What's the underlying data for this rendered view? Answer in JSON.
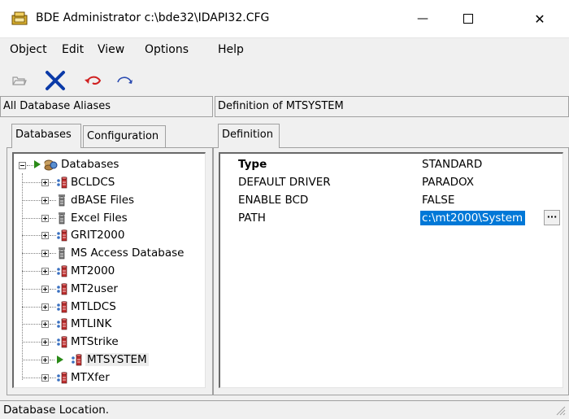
{
  "window": {
    "title": "BDE Administrator  c:\\bde32\\IDAPI32.CFG",
    "minimize_symbol": "—",
    "close_symbol": "✕"
  },
  "menu": {
    "object": "Object",
    "edit": "Edit",
    "view": "View",
    "options": "Options",
    "help": "Help"
  },
  "toolbar": {
    "icons": [
      "open-icon",
      "delete-icon",
      "undo-icon",
      "redo-icon"
    ]
  },
  "left_pane": {
    "header": "All Database Aliases",
    "tabs": [
      "Databases",
      "Configuration"
    ],
    "tree": {
      "root": "Databases",
      "items": [
        {
          "label": "BCLDCS",
          "icon": "database-icon"
        },
        {
          "label": "dBASE Files",
          "icon": "file-db-icon"
        },
        {
          "label": "Excel Files",
          "icon": "file-db-icon"
        },
        {
          "label": "GRIT2000",
          "icon": "database-icon"
        },
        {
          "label": "MS Access Database",
          "icon": "file-db-icon"
        },
        {
          "label": "MT2000",
          "icon": "database-icon"
        },
        {
          "label": "MT2user",
          "icon": "database-icon"
        },
        {
          "label": "MTLDCS",
          "icon": "database-icon"
        },
        {
          "label": "MTLINK",
          "icon": "database-icon"
        },
        {
          "label": "MTStrike",
          "icon": "database-icon"
        },
        {
          "label": "MTSYSTEM",
          "icon": "database-icon",
          "selected": true
        },
        {
          "label": "MTXfer",
          "icon": "database-icon"
        }
      ]
    }
  },
  "right_pane": {
    "header": "Definition of MTSYSTEM",
    "tab": "Definition",
    "properties": [
      {
        "name": "Type",
        "value": "STANDARD"
      },
      {
        "name": "DEFAULT DRIVER",
        "value": "PARADOX"
      },
      {
        "name": "ENABLE BCD",
        "value": "FALSE"
      },
      {
        "name": "PATH",
        "value": "c:\\mt2000\\System"
      }
    ],
    "ellipsis_label": "···"
  },
  "status": {
    "text": "Database Location."
  },
  "colors": {
    "selection": "#0078d7",
    "delete_x": "#0b3aa8",
    "undo_red": "#d02020",
    "tree_arrow": "#2a8a18"
  }
}
